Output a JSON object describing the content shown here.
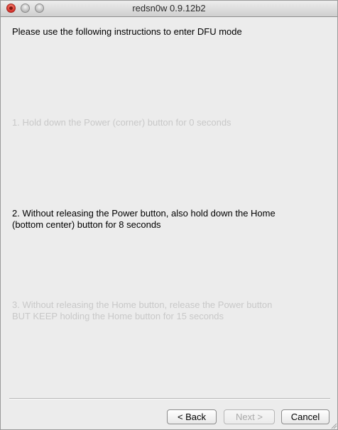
{
  "window": {
    "title": "redsn0w 0.9.12b2"
  },
  "instructions": {
    "heading": "Please use the following instructions to enter DFU mode",
    "step1": "1. Hold down the Power (corner) button for 0 seconds",
    "step2_line1": "2. Without releasing the Power button, also hold down the Home",
    "step2_line2": "(bottom center) button for 8 seconds",
    "step3_line1": "3. Without releasing the Home button, release the Power button",
    "step3_line2": "BUT KEEP holding the Home button for 15 seconds"
  },
  "buttons": {
    "back": "< Back",
    "next": "Next >",
    "cancel": "Cancel"
  },
  "icons": {
    "close": "close-icon",
    "minimize": "minimize-icon",
    "zoom": "zoom-icon",
    "resize": "resize-grip-icon"
  }
}
